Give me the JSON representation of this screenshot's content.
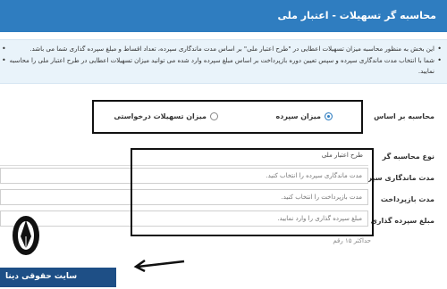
{
  "header": {
    "title": "محاسبه گر تسهیلات - اعتبار ملی"
  },
  "info": {
    "line1": "این بخش به منظور محاسبه میزان تسهیلات اعطایی در \"طرح اعتبار ملی\" بر اساس مدت ماندگاری سپرده، تعداد اقساط و مبلغ سپرده گذاری شما می باشد.",
    "line2": "شما با انتخاب مدت ماندگاری سپرده و سپس تعیین دوره بازپرداخت بر اساس مبلغ سپرده وارد شده می توانید میزان تسهیلات اعطایی در طرح اعتبار ملی را محاسبه",
    "line3": "نمایید."
  },
  "calc_basis": {
    "label": "محاسبه بر اساس",
    "option_deposit": "میزان سپرده",
    "option_facility": "میزان تسهیلات درخواستی",
    "selected": "option_deposit"
  },
  "form": {
    "calc_type_label": "نوع محاسبه گر",
    "calc_type_value": "طرح اعتبار ملی",
    "duration_label": "مدت ماندگاری سپرده",
    "duration_placeholder": "مدت ماندگاری سپرده را انتخاب کنید.",
    "repay_label": "مدت بازپرداخت",
    "repay_placeholder": "مدت بازپرداخت را انتخاب کنید.",
    "amount_label": "مبلغ سپرده گذاری",
    "amount_placeholder": "مبلغ سپرده گذاری را وارد نمایید.",
    "amount_hint": "حداکثر ۱۵ رقم"
  },
  "watermark": {
    "text": "سایت حقوقی دینا"
  }
}
